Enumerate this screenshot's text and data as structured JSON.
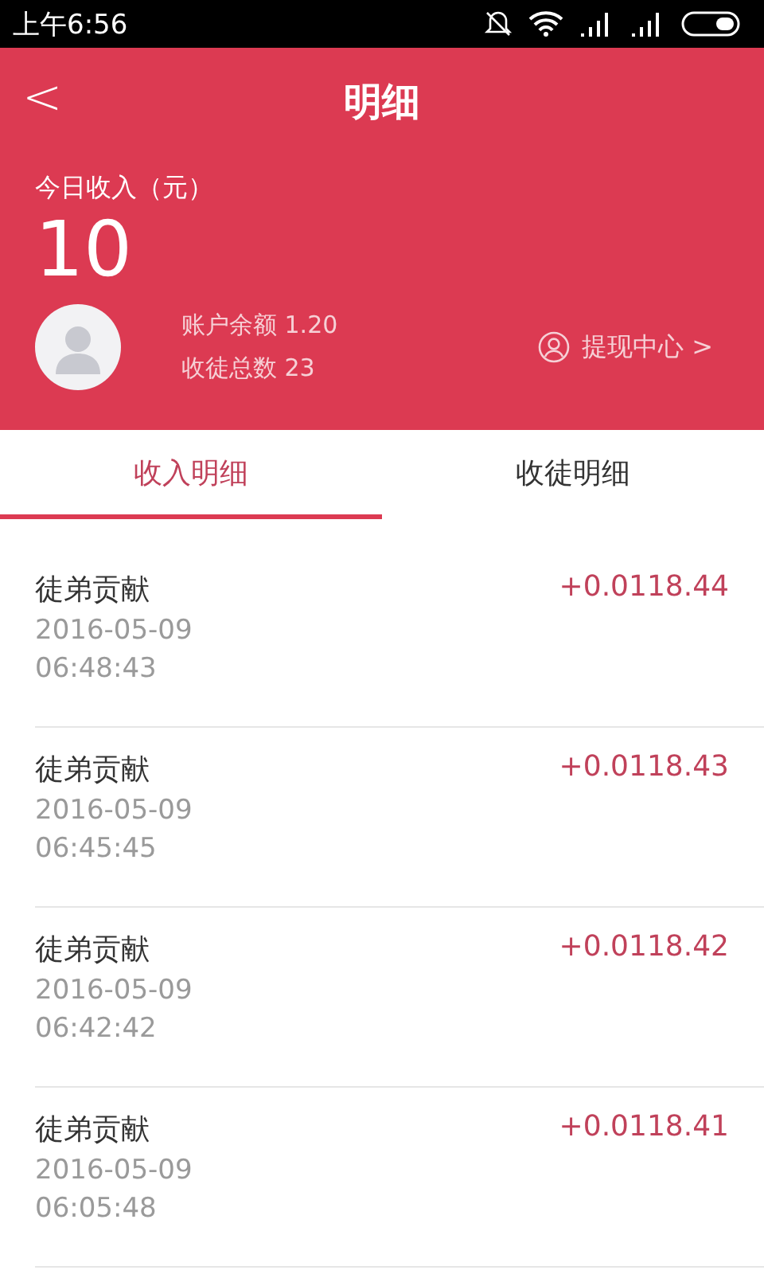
{
  "status_bar": {
    "time": "上午6:56"
  },
  "header": {
    "back": "<",
    "title": "明细"
  },
  "summary": {
    "label": "今日收入（元）",
    "amount": "10",
    "balance": "账户余额 1.20",
    "disciples": "收徒总数 23",
    "withdraw": "提现中心 >"
  },
  "tabs": [
    {
      "label": "收入明细",
      "selected": true
    },
    {
      "label": "收徒明细",
      "selected": false
    }
  ],
  "records": [
    {
      "title": "徒弟贡献",
      "date": "2016-05-09",
      "time": "06:48:43",
      "amount": "+0.0118.44"
    },
    {
      "title": "徒弟贡献",
      "date": "2016-05-09",
      "time": "06:45:45",
      "amount": "+0.0118.43"
    },
    {
      "title": "徒弟贡献",
      "date": "2016-05-09",
      "time": "06:42:42",
      "amount": "+0.0118.42"
    },
    {
      "title": "徒弟贡献",
      "date": "2016-05-09",
      "time": "06:05:48",
      "amount": "+0.0118.41"
    }
  ]
}
